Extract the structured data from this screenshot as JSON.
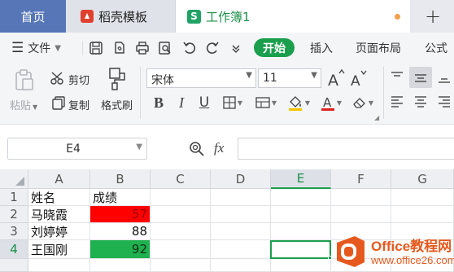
{
  "tabs": {
    "home": "首页",
    "template": "稻壳模板",
    "workbook": "工作簿1",
    "workbook_badge": "S",
    "new_tab": "+"
  },
  "menu": {
    "file": "文件",
    "start": "开始",
    "insert": "插入",
    "page_layout": "页面布局",
    "formula": "公式"
  },
  "ribbon": {
    "paste": "粘贴",
    "cut": "剪切",
    "copy": "复制",
    "format_painter": "格式刷",
    "font_name": "宋体",
    "font_size": "11"
  },
  "formula_bar": {
    "name_box": "E4",
    "fx_label": "fx",
    "formula": ""
  },
  "grid": {
    "columns": [
      "A",
      "B",
      "C",
      "D",
      "E",
      "F",
      "G"
    ],
    "active_column": "E",
    "rows": [
      "1",
      "2",
      "3",
      "4"
    ],
    "active_row": "4",
    "cells": [
      [
        "姓名",
        "成绩"
      ],
      [
        "马晓霞",
        "57"
      ],
      [
        "刘婷婷",
        "88"
      ],
      [
        "王国刚",
        "92"
      ]
    ],
    "selected_cell": "E4"
  },
  "colors": {
    "fail_fill": "#ff0000",
    "pass_fill": "#1fb14f",
    "fail_text": "#9c0006",
    "accent_green": "#1b9f4d",
    "home_tab": "#5676b8"
  },
  "watermark": {
    "title": "Office教程网",
    "url": "www.office26.com"
  }
}
